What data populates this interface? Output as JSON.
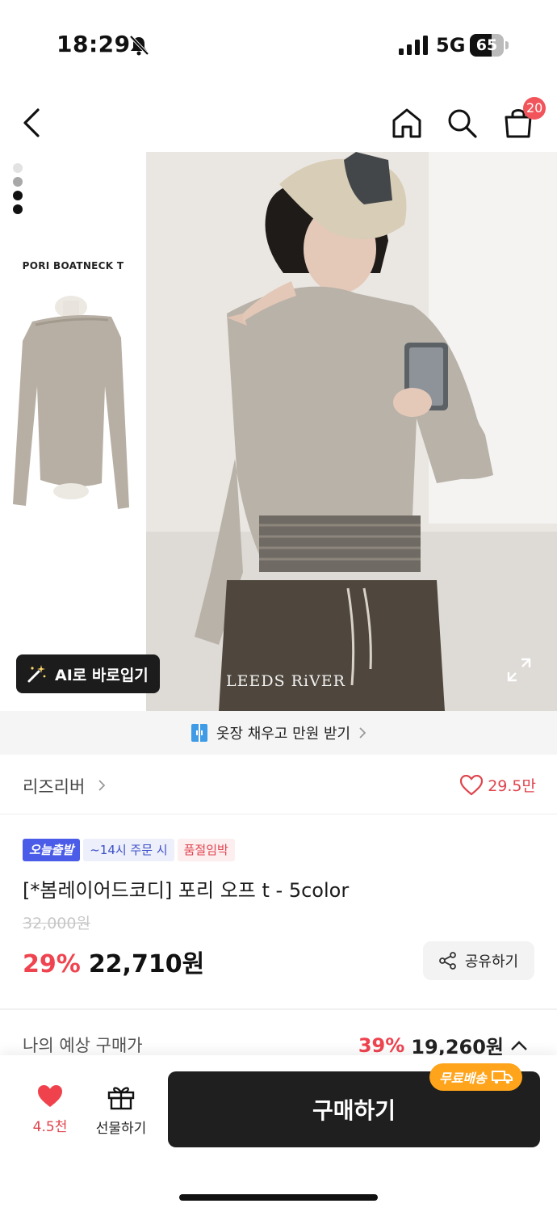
{
  "status_bar": {
    "time": "18:29",
    "network": "5G",
    "battery_level": "65",
    "icons": [
      "bell-mute-icon",
      "signal-icon",
      "battery-icon"
    ]
  },
  "nav": {
    "icons": [
      "back-arrow-icon",
      "home-icon",
      "search-icon",
      "shopping-bag-icon"
    ],
    "cart_count": "20"
  },
  "gallery": {
    "product_code": "PORI BOATNECK T",
    "brand_watermark": "LEEDS RiVER",
    "ai_button_label": "AI로 바로입기",
    "image_count": 4,
    "current_index": 1,
    "colors": {
      "shirt": "#b9b2a8",
      "background": "#ece9e5",
      "cap": "#d8cdb6"
    }
  },
  "closet_banner": {
    "label": "옷장 채우고 만원 받기"
  },
  "brand": {
    "name": "리즈리버",
    "likes": "29.5만"
  },
  "product": {
    "badges": {
      "express": "오늘출발",
      "order_cutoff": "~14시 주문 시",
      "stock": "품절임박"
    },
    "title": "[*봄레이어드코디] 포리 오프 t - 5color",
    "original_price": "32,000원",
    "discount": "29%",
    "sale_price": "22,710원",
    "share_label": "공유하기"
  },
  "expected": {
    "label": "나의 예상 구매가",
    "discount": "39%",
    "price": "19,260원"
  },
  "bottom_bar": {
    "wish_count": "4.5천",
    "gift_label": "선물하기",
    "buy_label": "구매하기",
    "free_shipping": "무료배송"
  },
  "colors": {
    "accent_red": "#ef4450",
    "express_blue": "#4a5ce8",
    "shipping_orange": "#ffa41b",
    "buy_button": "#1f1f1f"
  }
}
